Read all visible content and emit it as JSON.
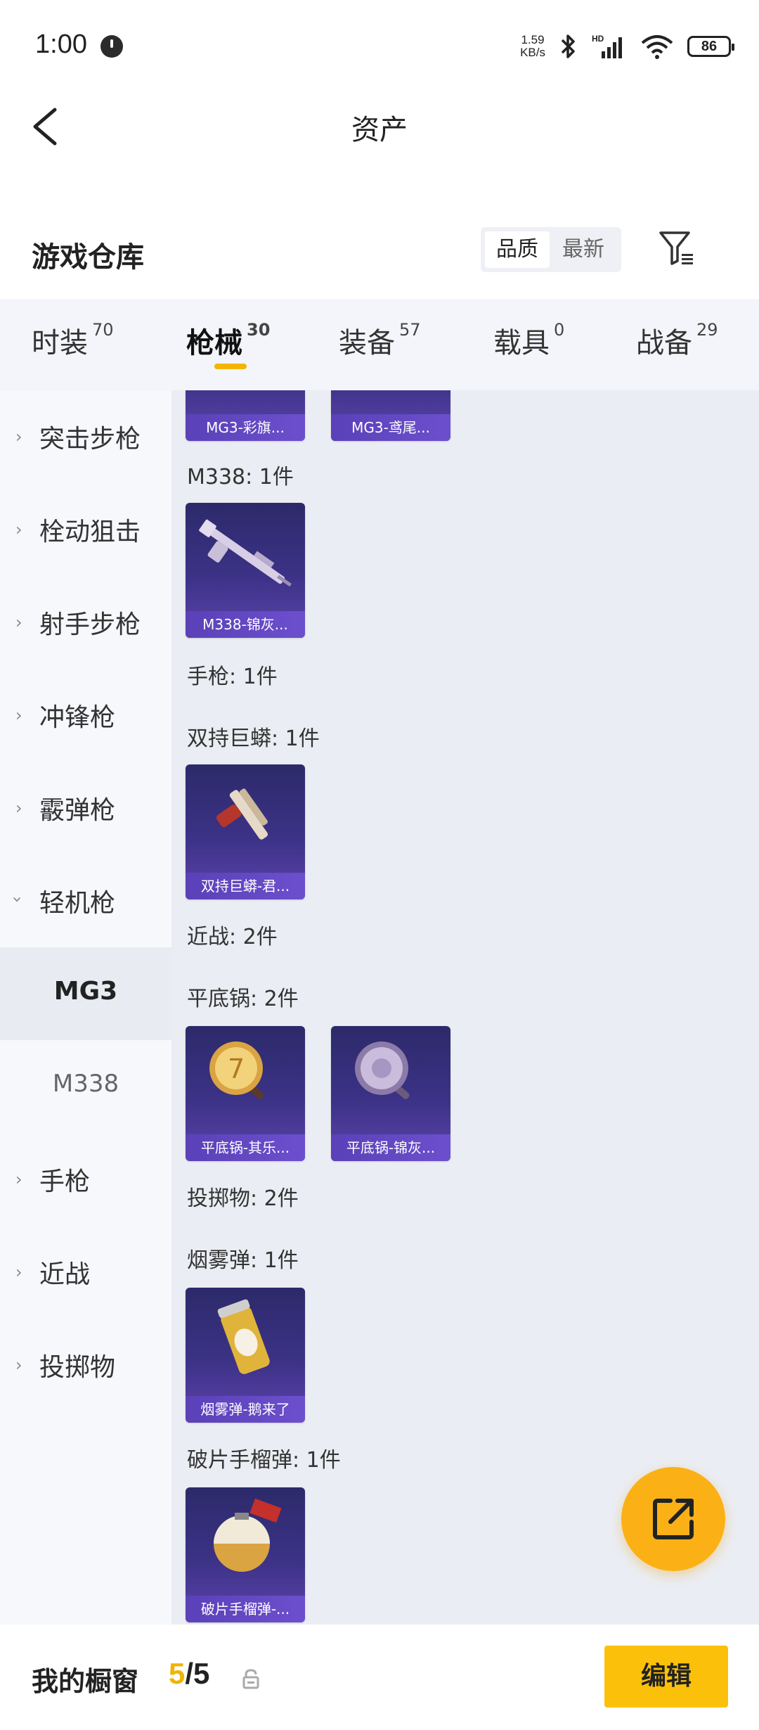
{
  "status_bar": {
    "time": "1:00",
    "net_speed_value": "1.59",
    "net_speed_unit": "KB/s",
    "battery": "86",
    "icons": [
      "alarm-icon",
      "bluetooth-icon",
      "signal-icon",
      "wifi-icon",
      "battery-icon"
    ]
  },
  "nav": {
    "title": "资产"
  },
  "warehouse": {
    "title": "游戏仓库",
    "sort_quality": "品质",
    "sort_latest": "最新"
  },
  "tabs": [
    {
      "label": "时装",
      "count": "70"
    },
    {
      "label": "枪械",
      "count": "30",
      "active": true
    },
    {
      "label": "装备",
      "count": "57"
    },
    {
      "label": "载具",
      "count": "0"
    },
    {
      "label": "战备",
      "count": "29"
    }
  ],
  "sidebar": {
    "items": [
      {
        "label": "突击步枪"
      },
      {
        "label": "栓动狙击"
      },
      {
        "label": "射手步枪"
      },
      {
        "label": "冲锋枪"
      },
      {
        "label": "霰弹枪"
      },
      {
        "label": "轻机枪",
        "expanded": true
      }
    ],
    "sub_items": [
      {
        "label": "MG3",
        "active": true
      },
      {
        "label": "M338"
      }
    ],
    "items_after": [
      {
        "label": "手枪"
      },
      {
        "label": "近战"
      },
      {
        "label": "投掷物"
      }
    ]
  },
  "content": {
    "top_cards": [
      "MG3-彩旗...",
      "MG3-鸢尾..."
    ],
    "sections": {
      "m338_label": "M338: 1件",
      "m338_card": "M338-锦灰...",
      "pistol_label": "手枪: 1件",
      "dual_label": "双持巨蟒: 1件",
      "dual_card": "双持巨蟒-君...",
      "melee_label": "近战: 2件",
      "pan_label": "平底锅: 2件",
      "pan_card_1": "平底锅-其乐...",
      "pan_card_2": "平底锅-锦灰...",
      "throw_label": "投掷物: 2件",
      "smoke_label": "烟雾弹: 1件",
      "smoke_card": "烟雾弹-鹅来了",
      "frag_label": "破片手榴弹: 1件",
      "frag_card": "破片手榴弹-..."
    }
  },
  "bottom_bar": {
    "title": "我的橱窗",
    "count_current": "5",
    "count_total": "/5",
    "edit_label": "编辑"
  },
  "colors": {
    "accent": "#fbc10a",
    "card_bg": "#3c3287",
    "card_caption": "#6c4fcd"
  }
}
